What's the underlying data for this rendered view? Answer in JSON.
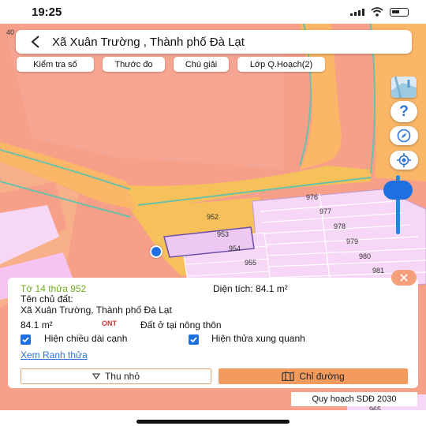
{
  "status_bar": {
    "time": "19:25"
  },
  "header": {
    "title": "Xã Xuân Trường , Thành phố Đà Lạt"
  },
  "toolbar": {
    "buttons": [
      "Kiểm tra số",
      "Thước đo",
      "Chú giải",
      "Lớp Q.Hoạch(2)"
    ]
  },
  "right_controls": {
    "help_symbol": "?"
  },
  "map": {
    "parcel_numbers": [
      "976",
      "977",
      "952",
      "978",
      "953",
      "979",
      "954",
      "980",
      "955",
      "981",
      "965"
    ],
    "corner_label": "40",
    "colors": {
      "residential_pink": "#f6a08a",
      "road_orange": "#fbb767",
      "road_yellow": "#f6c15a",
      "parcel_lilac": "#f6d7f5",
      "selected_parcel": "#ecc8f2"
    }
  },
  "info": {
    "parcel_title": "Tờ 14 thửa 952",
    "area_label": "Diện tích: 84.1 m²",
    "owner_label": "Tên chủ đất:",
    "owner_value": "Xã Xuân Trường, Thành phố Đà Lạt",
    "area_value": "84.1 m²",
    "land_code": "ONT",
    "land_type": "Đất ở tại nông thôn",
    "checkbox_edges": "Hiện chiều dài cạnh",
    "checkbox_neighbors": "Hiện thửa xung quanh",
    "link_boundary": "Xem Ranh thửa",
    "btn_collapse": "Thu nhỏ",
    "btn_route": "Chỉ đường"
  },
  "plan_label": "Quy hoạch SDĐ 2030"
}
